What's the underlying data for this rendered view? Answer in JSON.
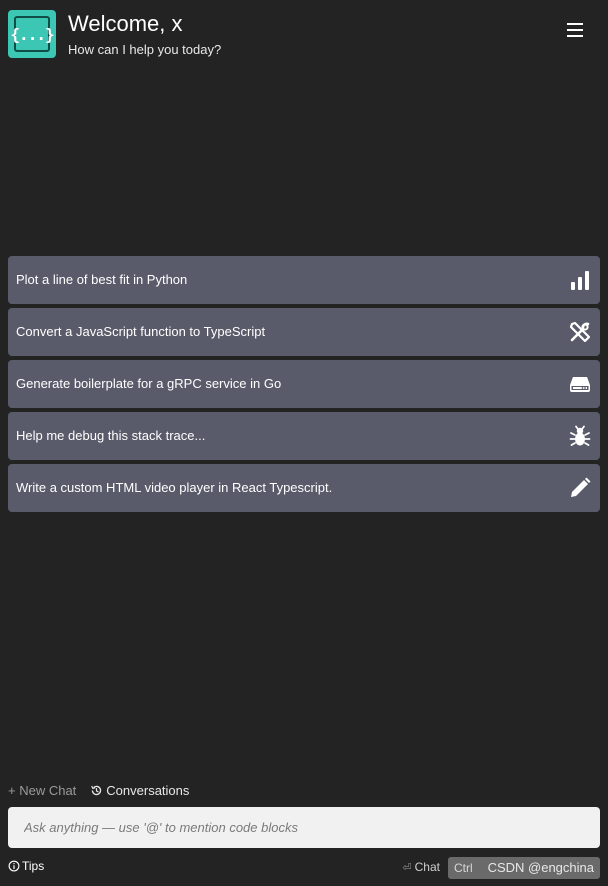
{
  "header": {
    "logo_text": "{...}",
    "title": "Welcome, x",
    "subtitle": "How can I help you today?",
    "menu_icon": "hamburger-menu-icon"
  },
  "suggestions": [
    {
      "label": "Plot a line of best fit in Python",
      "icon": "bar-chart-icon"
    },
    {
      "label": "Convert a JavaScript function to TypeScript",
      "icon": "tools-icon"
    },
    {
      "label": "Generate boilerplate for a gRPC service in Go",
      "icon": "server-icon"
    },
    {
      "label": "Help me debug this stack trace...",
      "icon": "bug-icon"
    },
    {
      "label": "Write a custom HTML video player in React Typescript.",
      "icon": "pencil-icon"
    }
  ],
  "links": {
    "new_chat": "+ New Chat",
    "conversations": "Conversations"
  },
  "input": {
    "placeholder": "Ask anything — use '@' to mention code blocks",
    "value": ""
  },
  "footer": {
    "tips": "Tips",
    "chat_enter": "⏎",
    "chat": "Chat",
    "ctrl": "Ctrl",
    "watermark": "CSDN @engchina"
  },
  "colors": {
    "background": "#232323",
    "card": "#595b6a",
    "logo": "#3cc7b4",
    "input_bg": "#f1f1f1"
  }
}
